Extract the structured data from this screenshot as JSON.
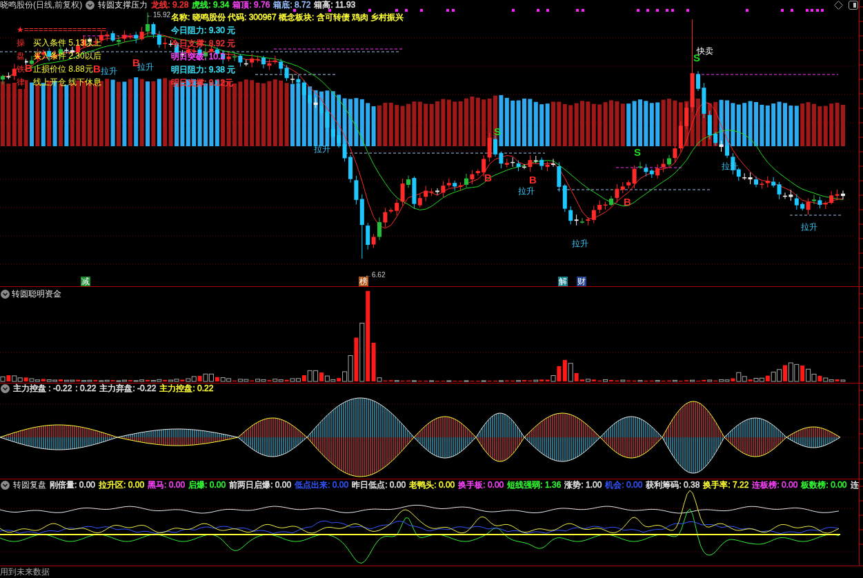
{
  "header": {
    "security": "晓鸣股份(日线,前复权)",
    "indicator": "转圆支撑压力",
    "readings": [
      {
        "text": "龙线: 9.28",
        "color": "#ff3333"
      },
      {
        "text": "虎线: 9.34",
        "color": "#33ff33"
      },
      {
        "text": "箱顶: 9.76",
        "color": "#ff44ff"
      },
      {
        "text": "箱底: 8.72",
        "color": "#99c2ff"
      },
      {
        "text": "箱高: 11.93",
        "color": "#e6e6e6"
      }
    ]
  },
  "stock_info": [
    {
      "text": "名称: 晓鸣股份 代码: 300967 概念板块: 含可转债 鸡肉 乡村振兴",
      "color": "#ffff33"
    },
    {
      "text": "今日阻力: 9.30 元",
      "color": "#33e6ff"
    },
    {
      "text": "今日支撑: 8.92 元",
      "color": "#ff3333"
    },
    {
      "text": "明日突破: 10.2",
      "color": "#ff44ff"
    },
    {
      "text": "明日阻力: 9.38 元",
      "color": "#33e6ff"
    },
    {
      "text": "明日支撑: 9.12元",
      "color": "#ff3333"
    }
  ],
  "trading_rules": {
    "banner": "★=================",
    "side_title": "操盘铁律",
    "lines": [
      "买入条件 5.13以上",
      "买入条件 2.30以后",
      "止损价位 8.88元",
      "线上开仓 线下休息"
    ]
  },
  "chart_labels": [
    {
      "kind": "buy",
      "text": "B"
    },
    {
      "kind": "buy",
      "text": "B"
    },
    {
      "kind": "rise",
      "text": "拉升"
    },
    {
      "kind": "buy",
      "text": "B"
    },
    {
      "kind": "rise",
      "text": "拉升"
    },
    {
      "kind": "rise",
      "text": "拉升"
    },
    {
      "kind": "sell",
      "text": "S"
    },
    {
      "kind": "buy",
      "text": "B"
    },
    {
      "kind": "buy",
      "text": "B"
    },
    {
      "kind": "rise",
      "text": "拉升"
    },
    {
      "kind": "rise",
      "text": "拉升"
    },
    {
      "kind": "buy",
      "text": "B"
    },
    {
      "kind": "sell",
      "text": "S"
    },
    {
      "kind": "sell",
      "text": "S"
    },
    {
      "kind": "quick_sell",
      "text": "快卖"
    },
    {
      "kind": "rise",
      "text": "拉升"
    },
    {
      "kind": "rise",
      "text": "拉升"
    },
    {
      "kind": "price",
      "text": "←15.92"
    },
    {
      "kind": "price",
      "text": "←6.62"
    }
  ],
  "chart_tags": [
    {
      "text": "减",
      "color": "#1a8a2e"
    },
    {
      "text": "榜",
      "color": "#b0561a"
    },
    {
      "text": "解",
      "color": "#12808a"
    },
    {
      "text": "财",
      "color": "#1f3f8f"
    }
  ],
  "fund_panel": {
    "title": "转圆聪明资金"
  },
  "control_panel": {
    "readings": [
      {
        "text": "主力控盘 : -0.22",
        "color": "#e6e6e6"
      },
      {
        "text": ": 0.22",
        "color": "#e6e6e6"
      },
      {
        "text": "主力弃盘: -0.22",
        "color": "#e6e6e6"
      },
      {
        "text": "主力控盘: 0.22",
        "color": "#ffff33"
      }
    ]
  },
  "review_panel": {
    "title": "转圆复盘",
    "readings": [
      {
        "text": "刚倍量: 0.00",
        "color": "#e6e6e6"
      },
      {
        "text": "拉升区: 0.00",
        "color": "#ffff33"
      },
      {
        "text": "黑马: 0.00",
        "color": "#ff44ff"
      },
      {
        "text": "启爆: 0.00",
        "color": "#33ff33"
      },
      {
        "text": "前两日启爆: 0.00",
        "color": "#e6e6e6"
      },
      {
        "text": "低点出来: 0.00",
        "color": "#3355ff"
      },
      {
        "text": "昨日低点: 0.00",
        "color": "#e6e6e6"
      },
      {
        "text": "老鸭头: 0.00",
        "color": "#ffff33"
      },
      {
        "text": "换手板: 0.00",
        "color": "#ff44ff"
      },
      {
        "text": "短线强弱: 1.36",
        "color": "#33ff33"
      },
      {
        "text": "涨势: 1.00",
        "color": "#e6e6e6"
      },
      {
        "text": "机会: 0.00",
        "color": "#3355ff"
      },
      {
        "text": "获利筹码: 0.38",
        "color": "#e6e6e6"
      },
      {
        "text": "换手率: 7.22",
        "color": "#ffff33"
      },
      {
        "text": "连板榜: 0.00",
        "color": "#ff44ff"
      },
      {
        "text": "板数榜: 0.00",
        "color": "#33ff33"
      },
      {
        "text": "连",
        "color": "#e6e6e6"
      }
    ]
  },
  "status_bar": {
    "text": "用到未来数据"
  }
}
